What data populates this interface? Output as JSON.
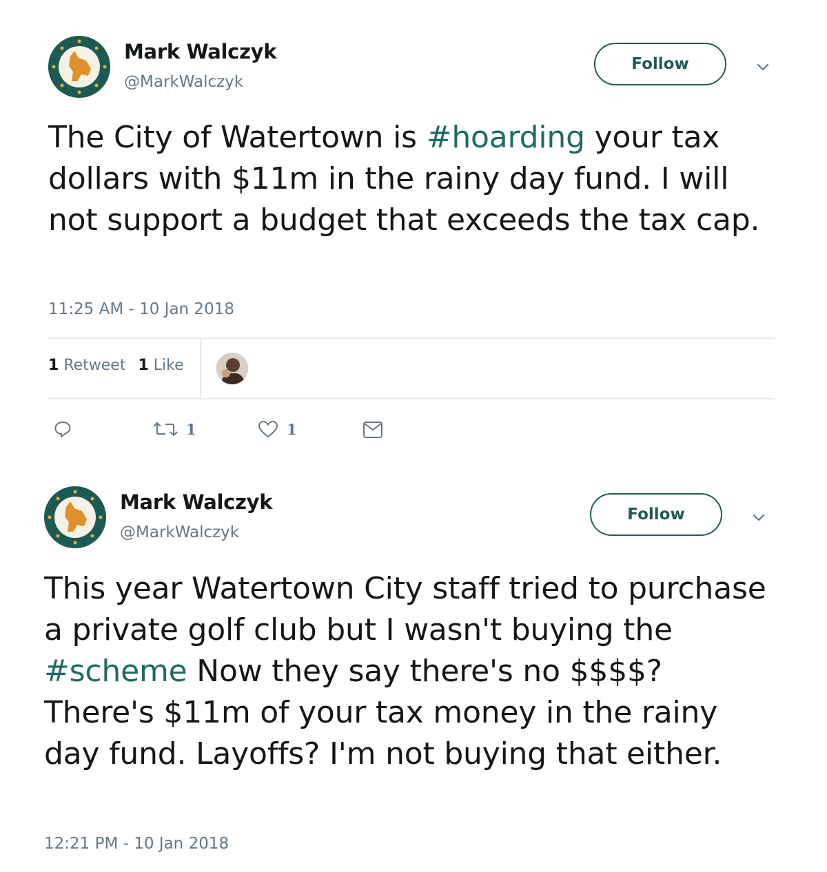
{
  "tweets": [
    {
      "author_name": "Mark Walczyk",
      "handle": "@MarkWalczyk",
      "follow_label": "Follow",
      "text_parts": [
        "The City of Watertown is ",
        "#hoarding",
        " your tax dollars with $11m in the rainy day fund. I will not support a budget that exceeds the tax cap."
      ],
      "timestamp": "11:25 AM - 10 Jan 2018",
      "retweet_count": "1",
      "retweet_label": "Retweet",
      "like_count": "1",
      "like_label": "Like",
      "action_retweet_count": "1",
      "action_like_count": "1"
    },
    {
      "author_name": "Mark Walczyk",
      "handle": "@MarkWalczyk",
      "follow_label": "Follow",
      "text_parts": [
        "This year Watertown City staff tried to purchase a private golf club but I wasn't buying the ",
        "#scheme",
        " Now they say there's no $$$$? There's $11m of your tax money in the rainy day fund. Layoffs? I'm not buying that either."
      ],
      "timestamp": "12:21 PM - 10 Jan 2018"
    }
  ],
  "colors": {
    "accent": "#245a53",
    "hashtag": "#1f6a63",
    "muted": "#657786",
    "avatar_bg": "#1e5a54",
    "avatar_logo": "#e0902a"
  }
}
